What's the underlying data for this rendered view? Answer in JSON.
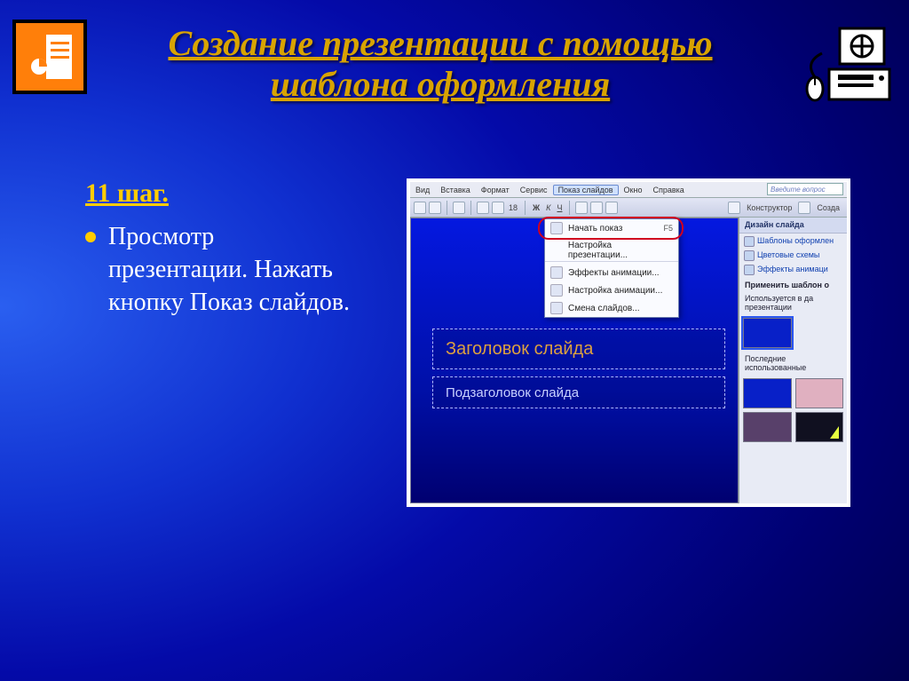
{
  "header": {
    "title_line1": "Создание презентации с помощью",
    "title_line2": "шаблона оформления"
  },
  "text": {
    "step_heading": "11 шаг.",
    "body": "Просмотр презентации. Нажать кнопку Показ слайдов."
  },
  "screenshot": {
    "menus": {
      "vid": "Вид",
      "vstavka": "Вставка",
      "format": "Формат",
      "servis": "Сервис",
      "show": "Показ слайдов",
      "okno": "Окно",
      "spravka": "Справка",
      "help_placeholder": "Введите вопрос"
    },
    "toolbar": {
      "fontsize": "18",
      "b": "Ж",
      "i": "К",
      "u": "Ч",
      "constructor": "Конструктор",
      "create": "Созда"
    },
    "dropdown": {
      "start": "Начать показ",
      "start_key": "F5",
      "setup": "Настройка презентации...",
      "anim_effects": "Эффекты анимации...",
      "anim_setup": "Настройка анимации...",
      "slide_change": "Смена слайдов..."
    },
    "canvas": {
      "title_placeholder": "Заголовок слайда",
      "subtitle_placeholder": "Подзаголовок слайда"
    },
    "rightpane": {
      "head": "Дизайн слайда",
      "templates": "Шаблоны оформлен",
      "colors": "Цветовые схемы",
      "anim": "Эффекты анимаци",
      "apply": "Применить шаблон о",
      "used": "Используется в да",
      "used2": "презентации",
      "recent": "Последние",
      "recent2": "использованные"
    }
  }
}
